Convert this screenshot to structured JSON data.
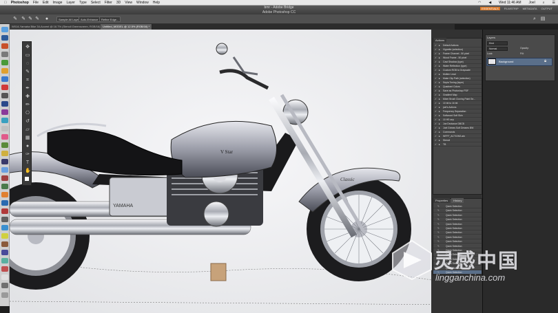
{
  "menubar": {
    "app": "Photoshop",
    "items": [
      "File",
      "Edit",
      "Image",
      "Layer",
      "Type",
      "Select",
      "Filter",
      "3D",
      "View",
      "Window",
      "Help"
    ],
    "clock": "Wed 11:46 AM",
    "user": "Joel"
  },
  "window": {
    "bridge_title": "bmr - Adobe Bridge",
    "title": "Adobe Photoshop CC",
    "workspaces": [
      "ESSENTIALS",
      "FILMSTRIP",
      "METADATA",
      "OUTPUT"
    ]
  },
  "options_bar": {
    "sample_all_layers": "Sample All Layers",
    "auto_enhance": "Auto-Enhance",
    "refine_edge": "Refine Edge..."
  },
  "doc_tabs": [
    "W014-Yamaha Bike 34-Accent @ 16.7% (Stencil Greenscreen, RGB/16) *",
    "Untitled_MODEL @ 12.5% (RGB/16) *"
  ],
  "actions_panel": {
    "tabs": [
      "Actions",
      "Layers"
    ],
    "rows": [
      "Default Actions",
      "Vignette (selection)",
      "Frame Channel - 50 pixel",
      "Wood Frame - 50 pixel",
      "Cast Shadow (type)",
      "Water Reflection (type)",
      "Custom RGB to Grayscale",
      "Molten Lead",
      "Make Clip Path (selection)",
      "Sepia Toning (layer)",
      "Quadrant Colors",
      "Save as Photoshop PDF",
      "Gradient Map",
      "Mixer Brush Cloning Paint Se...",
      "10 bit to 16 bit",
      "joel's Actions",
      "Frequency Separation",
      "Softwood Soft Skin",
      "10 HS sep",
      "Joe Deviance DBCB",
      "Joel Grimes Soft Dreams BW",
      "Commands",
      "WFFF_ACTIONS.atn",
      "Stencil",
      "TB"
    ]
  },
  "history_panel": {
    "tabs": [
      "Properties",
      "History"
    ],
    "rows": [
      "Quick Selection",
      "Quick Selection",
      "Quick Selection",
      "Quick Selection",
      "Quick Selection",
      "Quick Selection",
      "Quick Selection",
      "Quick Selection",
      "Quick Selection",
      "Quick Selection",
      "Quick Selection",
      "Quick Selection",
      "Quick Selection",
      "Quick Selection",
      "Quick Selection",
      "Quick Selection"
    ]
  },
  "layers_panel": {
    "title": "Layers",
    "kind": "Kind",
    "blend": "Normal",
    "opacity_label": "Opacity:",
    "fill_label": "Fill:",
    "lock_label": "Lock:",
    "layer_name": "Background"
  },
  "canvas": {
    "tank_badge": "V Star",
    "engine_label": "YAMAHA",
    "fender_label": "Classic"
  },
  "watermark": {
    "text": "灵感中国",
    "url": "lingganchina.com"
  },
  "colors": {
    "accent": "#d8782a",
    "panel": "#464646",
    "selected_layer": "#5a6f8a"
  }
}
